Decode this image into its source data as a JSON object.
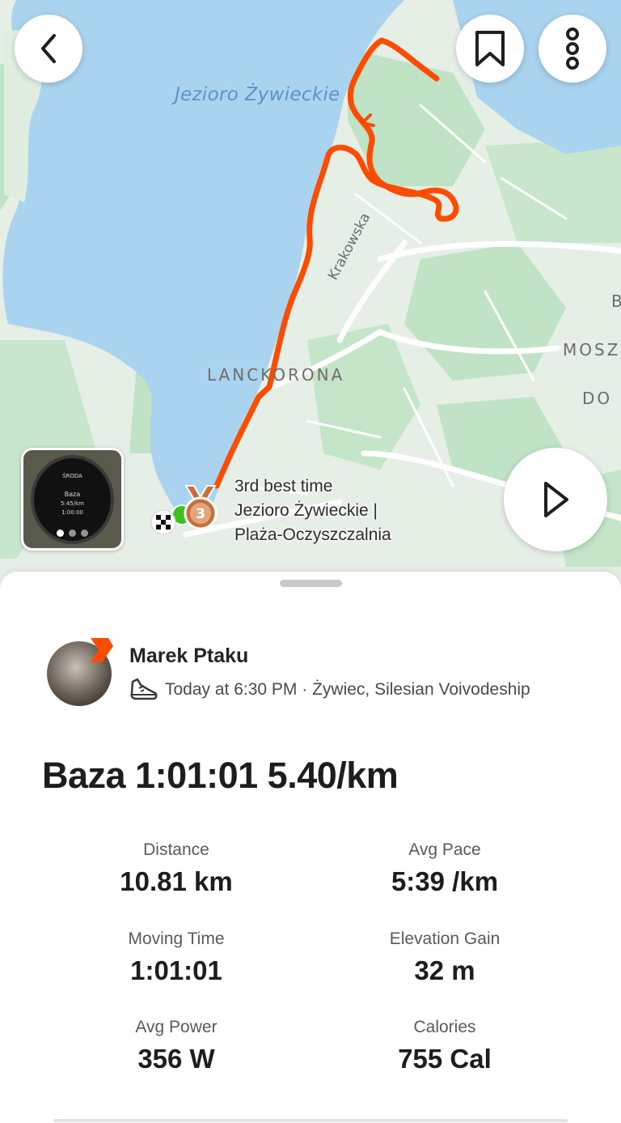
{
  "map": {
    "lake_label": "Jezioro Żywieckie",
    "road_label": "Krakowska",
    "town_label": "LANCKORONA",
    "town2_label": "MOSZ",
    "town3_label": "DO",
    "town4_label": "B",
    "segment": {
      "rank_text": "3rd best time",
      "rank_number": "3",
      "name_line1": "Jezioro Żywieckie |",
      "name_line2": "Plaża-Oczyszczalnia"
    },
    "route_color": "#fc4c02",
    "water_color": "#a9d3ef",
    "medal_color": "#c8703d"
  },
  "buttons": {
    "back_icon": "chevron-left-icon",
    "bookmark_icon": "bookmark-icon",
    "more_icon": "more-vertical-icon",
    "play_icon": "play-icon"
  },
  "photo": {
    "watch_day": "ŚRODA",
    "watch_workout": "Baza",
    "watch_pace": "5:45/km",
    "watch_time": "1:00:00",
    "pages": 3,
    "active_page": 1
  },
  "athlete": {
    "name": "Marek Ptaku",
    "activity_icon": "running-shoe-icon",
    "meta": "Today at 6:30 PM · Żywiec, Silesian Voivodeship",
    "accent": "#fc4c02"
  },
  "activity": {
    "title": "Baza 1:01:01 5.40/km"
  },
  "stats": [
    {
      "label": "Distance",
      "value": "10.81 km"
    },
    {
      "label": "Avg Pace",
      "value": "5:39 /km"
    },
    {
      "label": "Moving Time",
      "value": "1:01:01"
    },
    {
      "label": "Elevation Gain",
      "value": "32 m"
    },
    {
      "label": "Avg Power",
      "value": "356 W"
    },
    {
      "label": "Calories",
      "value": "755 Cal"
    }
  ]
}
